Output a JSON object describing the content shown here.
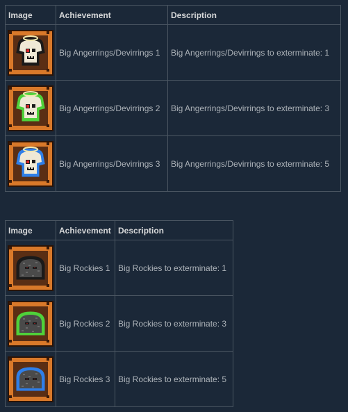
{
  "table1": {
    "headers": [
      "Image",
      "Achievement",
      "Description"
    ],
    "rows": [
      {
        "icon": "angerring-plain-icon",
        "frame_color": "#1a1a1a",
        "achievement": "Big Angerrings/Devirrings 1",
        "description": "Big Angerrings/Devirrings to exterminate: 1"
      },
      {
        "icon": "angerring-green-icon",
        "frame_color": "#4fd13a",
        "achievement": "Big Angerrings/Devirrings 2",
        "description": "Big Angerrings/Devirrings to exterminate: 3"
      },
      {
        "icon": "angerring-blue-icon",
        "frame_color": "#2f7fe8",
        "achievement": "Big Angerrings/Devirrings 3",
        "description": "Big Angerrings/Devirrings to exterminate: 5"
      }
    ]
  },
  "table2": {
    "headers": [
      "Image",
      "Achievement",
      "Description"
    ],
    "rows": [
      {
        "icon": "rocky-plain-icon",
        "frame_color": "#1a1a1a",
        "achievement": "Big Rockies 1",
        "description": "Big Rockies to exterminate: 1"
      },
      {
        "icon": "rocky-green-icon",
        "frame_color": "#4fd13a",
        "achievement": "Big Rockies 2",
        "description": "Big Rockies to exterminate: 3"
      },
      {
        "icon": "rocky-blue-icon",
        "frame_color": "#2f7fe8",
        "achievement": "Big Rockies 3",
        "description": "Big Rockies to exterminate: 5"
      }
    ]
  },
  "colors": {
    "background": "#1b2838",
    "border": "#4b5662",
    "header_text": "#d6d7d8",
    "cell_text": "#acb2b8",
    "frame_orange": "#d9792a"
  }
}
